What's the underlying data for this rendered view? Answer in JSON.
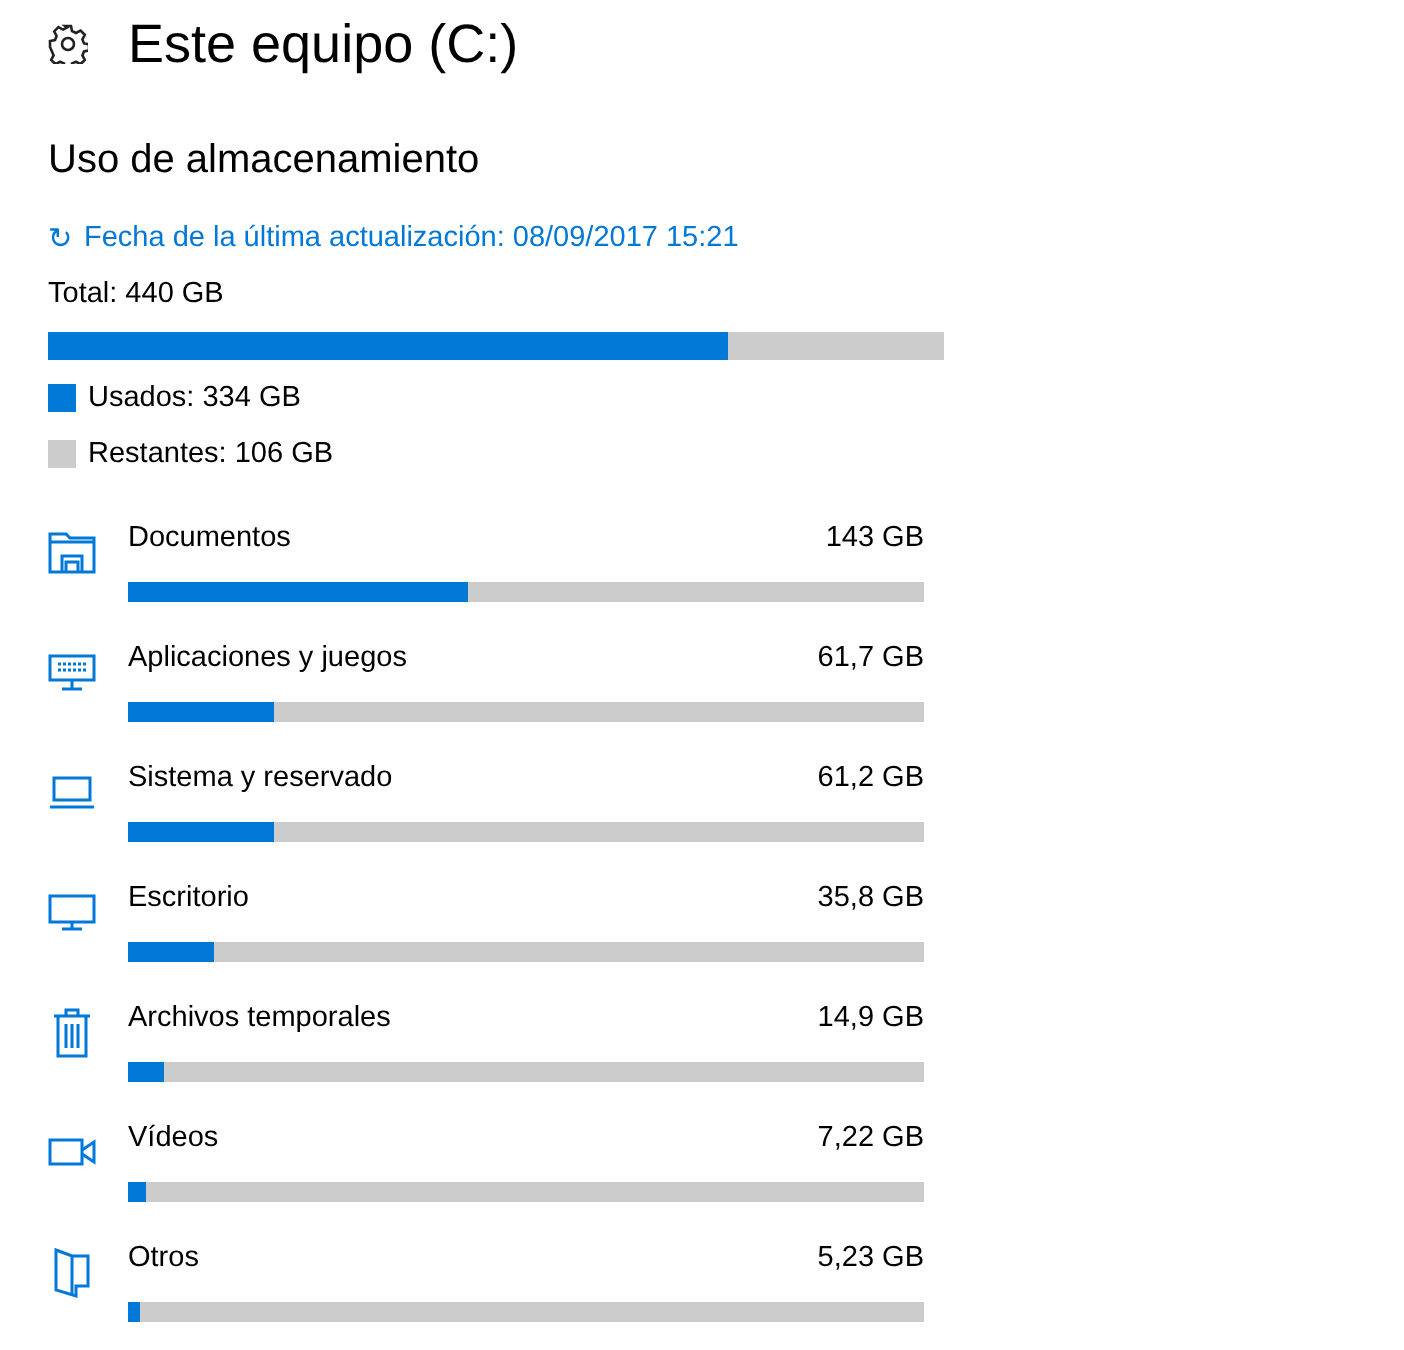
{
  "header": {
    "title": "Este equipo (C:)"
  },
  "section_title": "Uso de almacenamiento",
  "refresh": {
    "icon": "↻",
    "label": "Fecha de la última actualización: 08/09/2017 15:21"
  },
  "total": {
    "label": "Total: 440 GB",
    "level": 0.76
  },
  "legend": [
    {
      "label": "Usados: 334 GB",
      "color": "#0078d7"
    },
    {
      "label": "Restantes: 106 GB",
      "color": "#cccccc"
    }
  ],
  "categories": [
    {
      "kind": "folder",
      "name": "Documentos",
      "size": "143 GB",
      "level": 0.427
    },
    {
      "kind": "apps",
      "name": "Aplicaciones y juegos",
      "size": "61,7 GB",
      "level": 0.183
    },
    {
      "kind": "laptop",
      "name": "Sistema y reservado",
      "size": "61,2 GB",
      "level": 0.183
    },
    {
      "kind": "desktop",
      "name": "Escritorio",
      "size": "35,8 GB",
      "level": 0.108
    },
    {
      "kind": "trash",
      "name": "Archivos temporales",
      "size": "14,9 GB",
      "level": 0.045
    },
    {
      "kind": "video",
      "name": "Vídeos",
      "size": "7,22 GB",
      "level": 0.023
    },
    {
      "kind": "other",
      "name": "Otros",
      "size": "5,23 GB",
      "level": 0.015
    }
  ]
}
